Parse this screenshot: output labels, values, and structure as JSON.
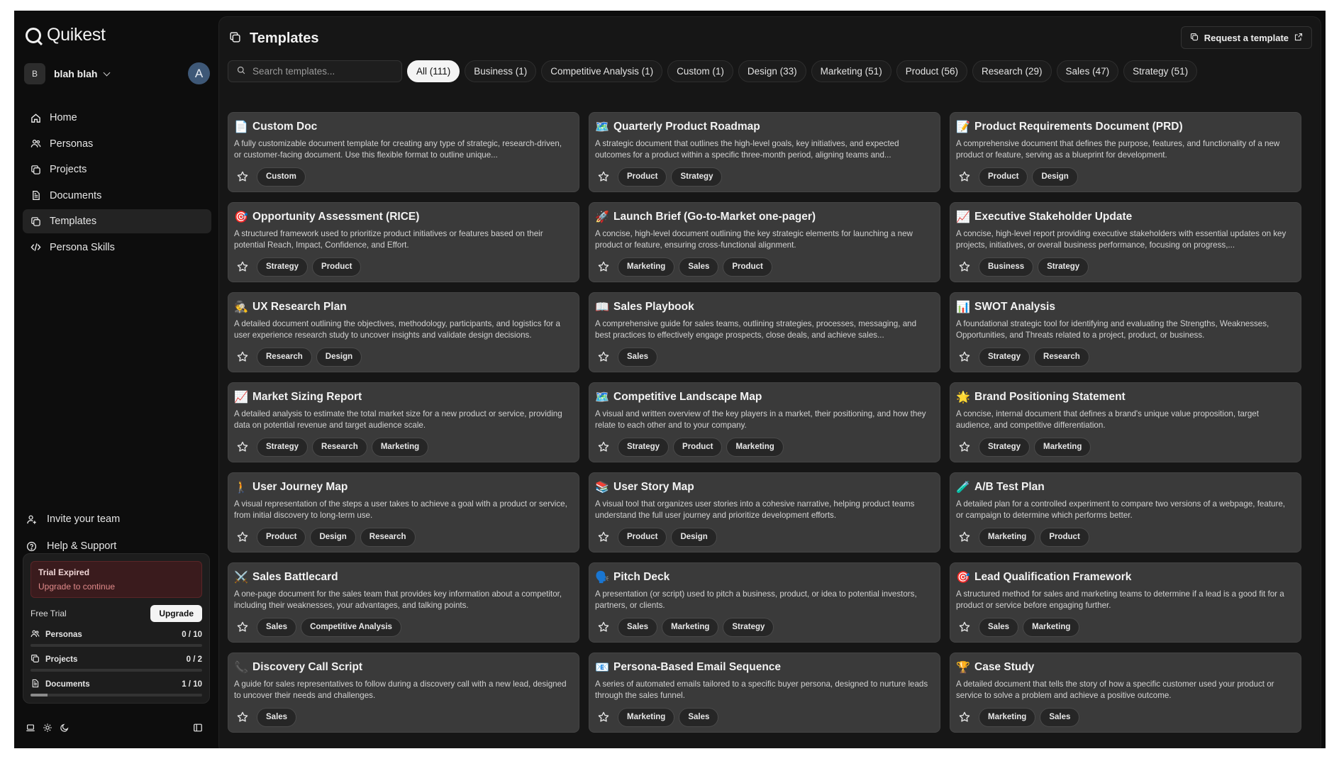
{
  "app": {
    "name": "Quikest"
  },
  "account": {
    "initial": "B",
    "name": "blah blah",
    "user_initial": "A"
  },
  "nav": [
    {
      "label": "Home",
      "icon": "home-icon"
    },
    {
      "label": "Personas",
      "icon": "users-icon"
    },
    {
      "label": "Projects",
      "icon": "copy-icon"
    },
    {
      "label": "Documents",
      "icon": "document-icon"
    },
    {
      "label": "Templates",
      "icon": "copy-icon",
      "active": true
    },
    {
      "label": "Persona Skills",
      "icon": "code-icon"
    }
  ],
  "bottom_links": {
    "invite": "Invite your team",
    "help": "Help & Support"
  },
  "trial": {
    "title": "Trial Expired",
    "subtitle": "Upgrade to continue",
    "plan": "Free Trial",
    "upgrade": "Upgrade",
    "usage": [
      {
        "label": "Personas",
        "count": "0 / 10",
        "fraction": 0.0
      },
      {
        "label": "Projects",
        "count": "0 / 2",
        "fraction": 0.0
      },
      {
        "label": "Documents",
        "count": "1 / 10",
        "fraction": 0.1
      }
    ]
  },
  "header": {
    "title": "Templates",
    "request_label": "Request a template"
  },
  "search": {
    "placeholder": "Search templates..."
  },
  "filters": [
    {
      "label": "All (111)",
      "active": true
    },
    {
      "label": "Business (1)"
    },
    {
      "label": "Competitive Analysis (1)"
    },
    {
      "label": "Custom (1)"
    },
    {
      "label": "Design (33)"
    },
    {
      "label": "Marketing (51)"
    },
    {
      "label": "Product (56)"
    },
    {
      "label": "Research (29)"
    },
    {
      "label": "Sales (47)"
    },
    {
      "label": "Strategy (51)"
    }
  ],
  "templates": [
    {
      "emoji": "📄",
      "title": "Custom Doc",
      "desc": "A fully customizable document template for creating any type of strategic, research-driven, or customer-facing document. Use this flexible format to outline unique...",
      "tags": [
        "Custom"
      ]
    },
    {
      "emoji": "🗺️",
      "title": "Quarterly Product Roadmap",
      "desc": "A strategic document that outlines the high-level goals, key initiatives, and expected outcomes for a product within a specific three-month period, aligning teams and...",
      "tags": [
        "Product",
        "Strategy"
      ]
    },
    {
      "emoji": "📝",
      "title": "Product Requirements Document (PRD)",
      "desc": "A comprehensive document that defines the purpose, features, and functionality of a new product or feature, serving as a blueprint for development.",
      "tags": [
        "Product",
        "Design"
      ]
    },
    {
      "emoji": "🎯",
      "title": "Opportunity Assessment (RICE)",
      "desc": "A structured framework used to prioritize product initiatives or features based on their potential Reach, Impact, Confidence, and Effort.",
      "tags": [
        "Strategy",
        "Product"
      ]
    },
    {
      "emoji": "🚀",
      "title": "Launch Brief (Go-to-Market one-pager)",
      "desc": "A concise, high-level document outlining the key strategic elements for launching a new product or feature, ensuring cross-functional alignment.",
      "tags": [
        "Marketing",
        "Sales",
        "Product"
      ]
    },
    {
      "emoji": "📈",
      "title": "Executive Stakeholder Update",
      "desc": "A concise, high-level report providing executive stakeholders with essential updates on key projects, initiatives, or overall business performance, focusing on progress,...",
      "tags": [
        "Business",
        "Strategy"
      ]
    },
    {
      "emoji": "🕵️",
      "title": "UX Research Plan",
      "desc": "A detailed document outlining the objectives, methodology, participants, and logistics for a user experience research study to uncover insights and validate design decisions.",
      "tags": [
        "Research",
        "Design"
      ]
    },
    {
      "emoji": "📖",
      "title": "Sales Playbook",
      "desc": "A comprehensive guide for sales teams, outlining strategies, processes, messaging, and best practices to effectively engage prospects, close deals, and achieve sales...",
      "tags": [
        "Sales"
      ]
    },
    {
      "emoji": "📊",
      "title": "SWOT Analysis",
      "desc": "A foundational strategic tool for identifying and evaluating the Strengths, Weaknesses, Opportunities, and Threats related to a project, product, or business.",
      "tags": [
        "Strategy",
        "Research"
      ]
    },
    {
      "emoji": "📈",
      "title": "Market Sizing Report",
      "desc": "A detailed analysis to estimate the total market size for a new product or service, providing data on potential revenue and target audience scale.",
      "tags": [
        "Strategy",
        "Research",
        "Marketing"
      ]
    },
    {
      "emoji": "🗺️",
      "title": "Competitive Landscape Map",
      "desc": "A visual and written overview of the key players in a market, their positioning, and how they relate to each other and to your company.",
      "tags": [
        "Strategy",
        "Product",
        "Marketing"
      ]
    },
    {
      "emoji": "🌟",
      "title": "Brand Positioning Statement",
      "desc": "A concise, internal document that defines a brand's unique value proposition, target audience, and competitive differentiation.",
      "tags": [
        "Strategy",
        "Marketing"
      ]
    },
    {
      "emoji": "🚶",
      "title": "User Journey Map",
      "desc": "A visual representation of the steps a user takes to achieve a goal with a product or service, from initial discovery to long-term use.",
      "tags": [
        "Product",
        "Design",
        "Research"
      ]
    },
    {
      "emoji": "📚",
      "title": "User Story Map",
      "desc": "A visual tool that organizes user stories into a cohesive narrative, helping product teams understand the full user journey and prioritize development efforts.",
      "tags": [
        "Product",
        "Design"
      ]
    },
    {
      "emoji": "🧪",
      "title": "A/B Test Plan",
      "desc": "A detailed plan for a controlled experiment to compare two versions of a webpage, feature, or campaign to determine which performs better.",
      "tags": [
        "Marketing",
        "Product"
      ]
    },
    {
      "emoji": "⚔️",
      "title": "Sales Battlecard",
      "desc": "A one-page document for the sales team that provides key information about a competitor, including their weaknesses, your advantages, and talking points.",
      "tags": [
        "Sales",
        "Competitive Analysis"
      ]
    },
    {
      "emoji": "🗣️",
      "title": "Pitch Deck",
      "desc": "A presentation (or script) used to pitch a business, product, or idea to potential investors, partners, or clients.",
      "tags": [
        "Sales",
        "Marketing",
        "Strategy"
      ]
    },
    {
      "emoji": "🎯",
      "title": "Lead Qualification Framework",
      "desc": "A structured method for sales and marketing teams to determine if a lead is a good fit for a product or service before engaging further.",
      "tags": [
        "Sales",
        "Marketing"
      ]
    },
    {
      "emoji": "📞",
      "title": "Discovery Call Script",
      "desc": "A guide for sales representatives to follow during a discovery call with a new lead, designed to uncover their needs and challenges.",
      "tags": [
        "Sales"
      ]
    },
    {
      "emoji": "📧",
      "title": "Persona-Based Email Sequence",
      "desc": "A series of automated emails tailored to a specific buyer persona, designed to nurture leads through the sales funnel.",
      "tags": [
        "Marketing",
        "Sales"
      ]
    },
    {
      "emoji": "🏆",
      "title": "Case Study",
      "desc": "A detailed document that tells the story of how a specific customer used your product or service to solve a problem and achieve a positive outcome.",
      "tags": [
        "Marketing",
        "Sales"
      ]
    }
  ]
}
